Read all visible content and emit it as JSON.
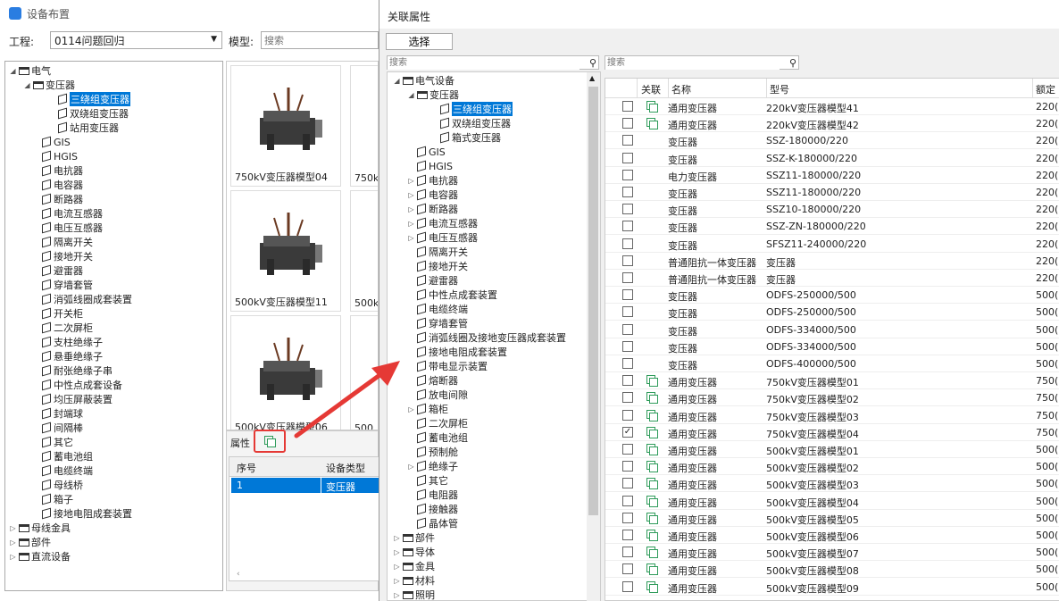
{
  "window_title": "设备布置",
  "project": {
    "label": "工程:",
    "value": "0114问题回归"
  },
  "model": {
    "label": "模型:",
    "placeholder": "搜索"
  },
  "left_tree": {
    "root": "电气",
    "transformer": "变压器",
    "transformer_children": [
      "三绕组变压器",
      "双绕组变压器",
      "站用变压器"
    ],
    "items": [
      "GIS",
      "HGIS",
      "电抗器",
      "电容器",
      "断路器",
      "电流互感器",
      "电压互感器",
      "隔离开关",
      "接地开关",
      "避雷器",
      "穿墙套管",
      "消弧线圈成套装置",
      "开关柜",
      "二次屏柜",
      "支柱绝缘子",
      "悬垂绝缘子",
      "耐张绝缘子串",
      "中性点成套设备",
      "均压屏蔽装置",
      "封端球",
      "间隔棒",
      "其它",
      "蓄电池组",
      "电缆终端",
      "母线桥",
      "箱子",
      "接地电阻成套装置"
    ],
    "roots": [
      "母线金具",
      "部件",
      "直流设备"
    ]
  },
  "thumbs": [
    "750kV变压器模型04",
    "750k",
    "500kV变压器模型11",
    "500k",
    "500kV变压器模型06",
    "500"
  ],
  "props_panel": {
    "title": "属性",
    "col_index": "序号",
    "col_type": "设备类型",
    "row_index": "1",
    "row_type": "变压器"
  },
  "dialog": {
    "title": "关联属性",
    "select_button": "选择",
    "search_left_placeholder": "搜索",
    "search_right_placeholder": "搜索",
    "tree_root": "电气设备",
    "tree_transformer": "变压器",
    "tree_transformer_children": [
      "三绕组变压器",
      "双绕组变压器",
      "箱式变压器"
    ],
    "tree_items": [
      {
        "label": "GIS",
        "exp": false
      },
      {
        "label": "HGIS",
        "exp": false
      },
      {
        "label": "电抗器",
        "exp": true
      },
      {
        "label": "电容器",
        "exp": true
      },
      {
        "label": "断路器",
        "exp": true
      },
      {
        "label": "电流互感器",
        "exp": true
      },
      {
        "label": "电压互感器",
        "exp": true
      },
      {
        "label": "隔离开关",
        "exp": false
      },
      {
        "label": "接地开关",
        "exp": false
      },
      {
        "label": "避雷器",
        "exp": false
      },
      {
        "label": "中性点成套装置",
        "exp": false
      },
      {
        "label": "电缆终端",
        "exp": false
      },
      {
        "label": "穿墙套管",
        "exp": false
      },
      {
        "label": "消弧线圈及接地变压器成套装置",
        "exp": false
      },
      {
        "label": "接地电阻成套装置",
        "exp": false
      },
      {
        "label": "带电显示装置",
        "exp": false
      },
      {
        "label": "熔断器",
        "exp": false
      },
      {
        "label": "放电间隙",
        "exp": false
      },
      {
        "label": "箱柜",
        "exp": true
      },
      {
        "label": "二次屏柜",
        "exp": false
      },
      {
        "label": "蓄电池组",
        "exp": false
      },
      {
        "label": "预制舱",
        "exp": false
      },
      {
        "label": "绝缘子",
        "exp": true
      },
      {
        "label": "其它",
        "exp": false
      },
      {
        "label": "电阻器",
        "exp": false
      },
      {
        "label": "接触器",
        "exp": false
      },
      {
        "label": "晶体管",
        "exp": false
      }
    ],
    "tree_roots": [
      "部件",
      "导体",
      "金具",
      "材料",
      "照明"
    ],
    "table_headers": [
      "关联",
      "名称",
      "型号",
      "额定"
    ],
    "rows": [
      {
        "rel": true,
        "name": "通用变压器",
        "model": "220kV变压器模型41",
        "rated": "220("
      },
      {
        "rel": true,
        "name": "通用变压器",
        "model": "220kV变压器模型42",
        "rated": "220("
      },
      {
        "rel": false,
        "name": "变压器",
        "model": "SSZ-180000/220",
        "rated": "220("
      },
      {
        "rel": false,
        "name": "变压器",
        "model": "SSZ-K-180000/220",
        "rated": "220("
      },
      {
        "rel": false,
        "name": "电力变压器",
        "model": "SSZ11-180000/220",
        "rated": "220("
      },
      {
        "rel": false,
        "name": "变压器",
        "model": "SSZ11-180000/220",
        "rated": "220("
      },
      {
        "rel": false,
        "name": "变压器",
        "model": "SSZ10-180000/220",
        "rated": "220("
      },
      {
        "rel": false,
        "name": "变压器",
        "model": "SSZ-ZN-180000/220",
        "rated": "220("
      },
      {
        "rel": false,
        "name": "变压器",
        "model": "SFSZ11-240000/220",
        "rated": "220("
      },
      {
        "rel": false,
        "name": "普通阻抗一体变压器",
        "model": "变压器",
        "rated": "220("
      },
      {
        "rel": false,
        "name": "普通阻抗一体变压器",
        "model": "变压器",
        "rated": "220("
      },
      {
        "rel": false,
        "name": "变压器",
        "model": "ODFS-250000/500",
        "rated": "500("
      },
      {
        "rel": false,
        "name": "变压器",
        "model": "ODFS-250000/500",
        "rated": "500("
      },
      {
        "rel": false,
        "name": "变压器",
        "model": "ODFS-334000/500",
        "rated": "500("
      },
      {
        "rel": false,
        "name": "变压器",
        "model": "ODFS-334000/500",
        "rated": "500("
      },
      {
        "rel": false,
        "name": "变压器",
        "model": "ODFS-400000/500",
        "rated": "500("
      },
      {
        "rel": true,
        "name": "通用变压器",
        "model": "750kV变压器模型01",
        "rated": "750("
      },
      {
        "rel": true,
        "name": "通用变压器",
        "model": "750kV变压器模型02",
        "rated": "750("
      },
      {
        "rel": true,
        "name": "通用变压器",
        "model": "750kV变压器模型03",
        "rated": "750("
      },
      {
        "rel": true,
        "name": "通用变压器",
        "model": "750kV变压器模型04",
        "rated": "750(",
        "checked": true
      },
      {
        "rel": true,
        "name": "通用变压器",
        "model": "500kV变压器模型01",
        "rated": "500("
      },
      {
        "rel": true,
        "name": "通用变压器",
        "model": "500kV变压器模型02",
        "rated": "500("
      },
      {
        "rel": true,
        "name": "通用变压器",
        "model": "500kV变压器模型03",
        "rated": "500("
      },
      {
        "rel": true,
        "name": "通用变压器",
        "model": "500kV变压器模型04",
        "rated": "500("
      },
      {
        "rel": true,
        "name": "通用变压器",
        "model": "500kV变压器模型05",
        "rated": "500("
      },
      {
        "rel": true,
        "name": "通用变压器",
        "model": "500kV变压器模型06",
        "rated": "500("
      },
      {
        "rel": true,
        "name": "通用变压器",
        "model": "500kV变压器模型07",
        "rated": "500("
      },
      {
        "rel": true,
        "name": "通用变压器",
        "model": "500kV变压器模型08",
        "rated": "500("
      },
      {
        "rel": true,
        "name": "通用变压器",
        "model": "500kV变压器模型09",
        "rated": "500("
      }
    ]
  },
  "colors": {
    "selection": "#0078d7",
    "highlight_box": "#e53935",
    "arrow": "#e53935",
    "rel_icon": "#2e9b5a"
  }
}
